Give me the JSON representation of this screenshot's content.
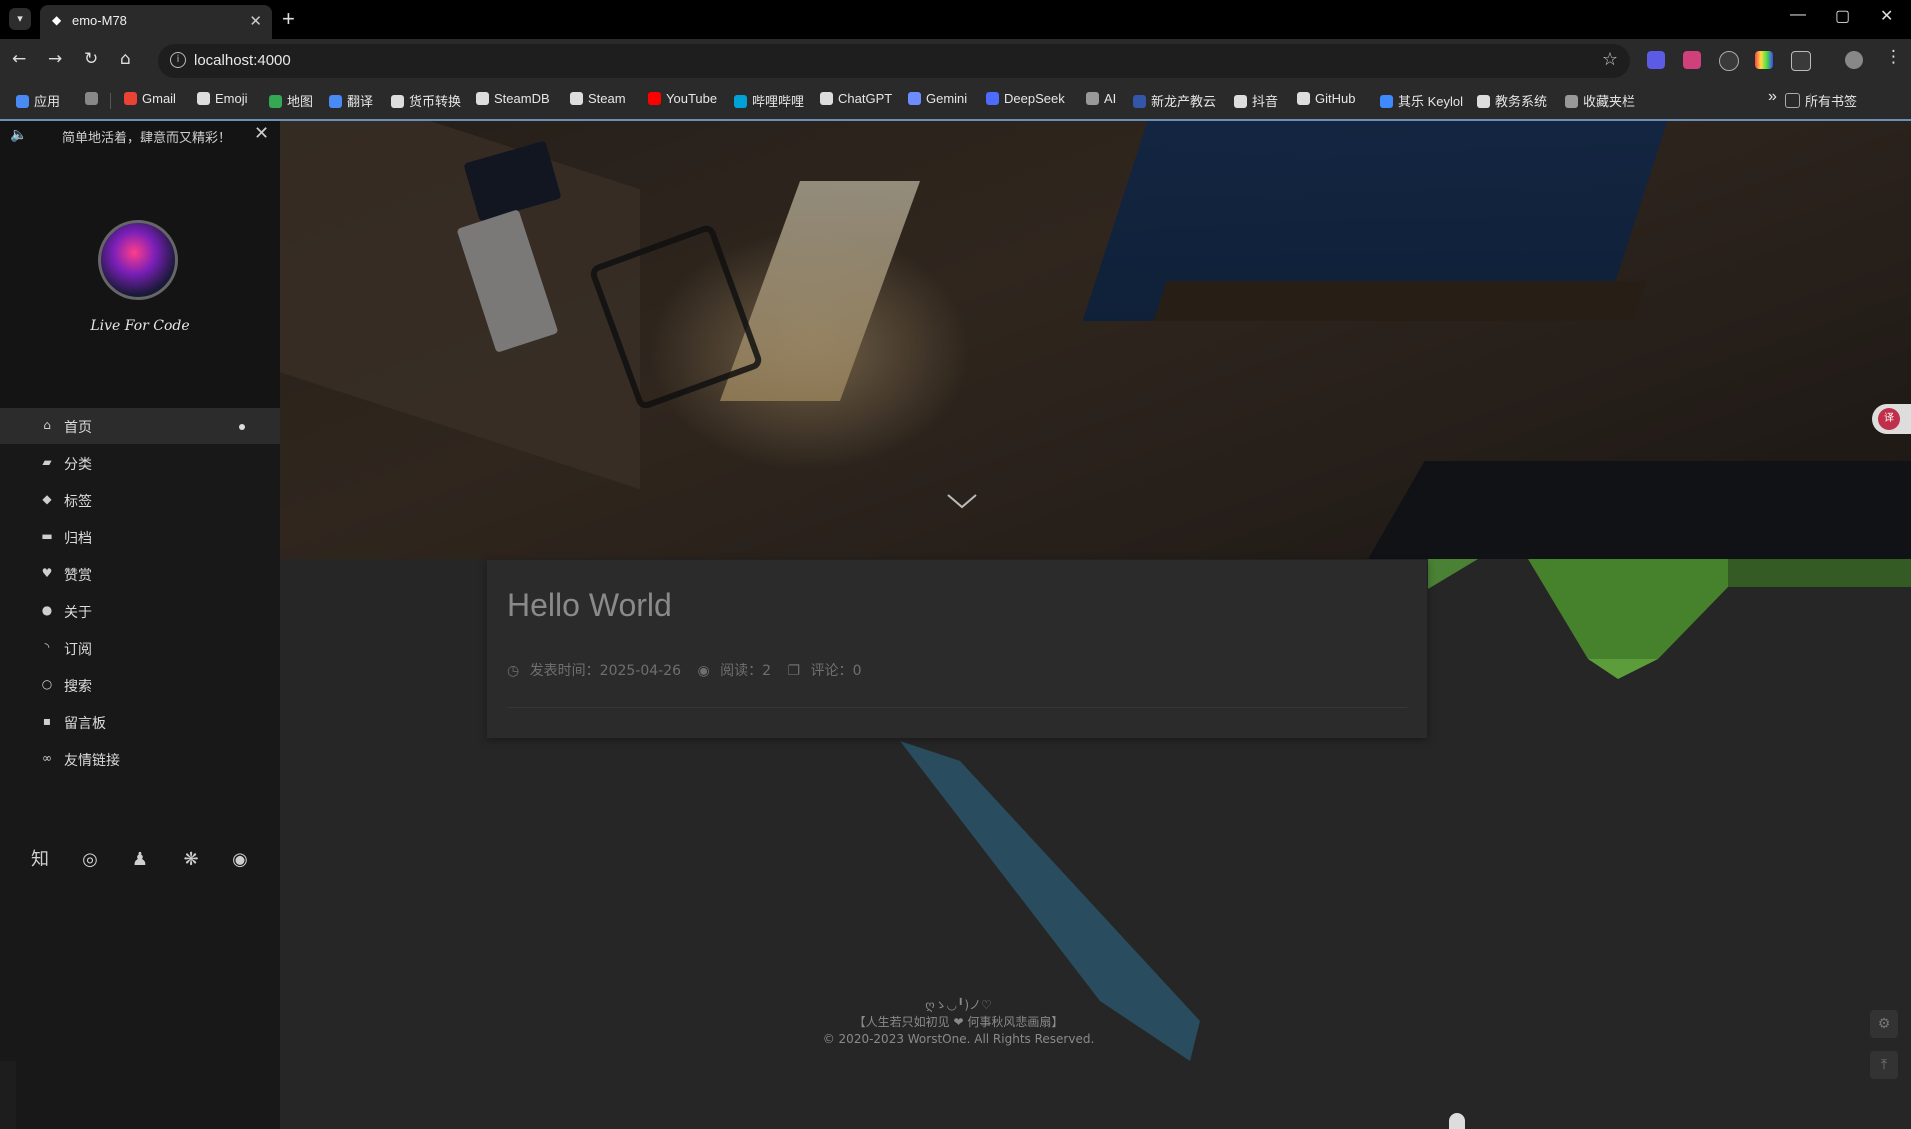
{
  "browser": {
    "tab_title": "emo-M78",
    "url": "localhost:4000",
    "bookmarks": [
      {
        "label": "应用",
        "color": "#4a8af4"
      },
      {
        "label": "",
        "color": "#888888"
      },
      {
        "label": "Gmail",
        "color": "#ea4335"
      },
      {
        "label": "Emoji",
        "color": "#dddddd"
      },
      {
        "label": "地图",
        "color": "#34a853"
      },
      {
        "label": "翻译",
        "color": "#4a8af4"
      },
      {
        "label": "货币转换",
        "color": "#dddddd"
      },
      {
        "label": "SteamDB",
        "color": "#dddddd"
      },
      {
        "label": "Steam",
        "color": "#dddddd"
      },
      {
        "label": "YouTube",
        "color": "#ff0000"
      },
      {
        "label": "哔哩哔哩",
        "color": "#00a1d6"
      },
      {
        "label": "ChatGPT",
        "color": "#dddddd"
      },
      {
        "label": "Gemini",
        "color": "#6c8cff"
      },
      {
        "label": "DeepSeek",
        "color": "#4d6bfe"
      },
      {
        "label": "AI",
        "color": "#999999"
      },
      {
        "label": "新龙产教云",
        "color": "#3355aa"
      },
      {
        "label": "抖音",
        "color": "#dddddd"
      },
      {
        "label": "GitHub",
        "color": "#dddddd"
      },
      {
        "label": "其乐 Keylol",
        "color": "#3d8bff"
      },
      {
        "label": "教务系统",
        "color": "#dddddd"
      },
      {
        "label": "收藏夹栏",
        "color": "#999999"
      }
    ],
    "all_bookmarks": "所有书签"
  },
  "sidebar": {
    "motto": "简单地活着，肆意而又精彩！",
    "site_name": "Live For Code",
    "menu": [
      {
        "label": "首页",
        "icon": "home-icon",
        "glyph": "⌂",
        "active": true
      },
      {
        "label": "分类",
        "icon": "folder-icon",
        "glyph": "▰"
      },
      {
        "label": "标签",
        "icon": "tag-icon",
        "glyph": "◆"
      },
      {
        "label": "归档",
        "icon": "archive-icon",
        "glyph": "▬"
      },
      {
        "label": "赞赏",
        "icon": "heart-icon",
        "glyph": "♥"
      },
      {
        "label": "关于",
        "icon": "user-icon",
        "glyph": "●"
      },
      {
        "label": "订阅",
        "icon": "rss-icon",
        "glyph": "◝"
      },
      {
        "label": "搜索",
        "icon": "search-icon",
        "glyph": "○"
      },
      {
        "label": "留言板",
        "icon": "comment-icon",
        "glyph": "▪"
      },
      {
        "label": "友情链接",
        "icon": "link-icon",
        "glyph": "∞"
      }
    ],
    "socials": [
      {
        "icon": "zhihu-icon",
        "glyph": "知"
      },
      {
        "icon": "weibo-icon",
        "glyph": "◎"
      },
      {
        "icon": "qq-icon",
        "glyph": "♟"
      },
      {
        "icon": "wechat-icon",
        "glyph": "❋"
      },
      {
        "icon": "github-icon",
        "glyph": "◉"
      }
    ]
  },
  "post": {
    "title": "Hello World",
    "published_label": "发表时间：",
    "published_date": "2025-04-26",
    "reads_label": "阅读：",
    "reads": "2",
    "comments_label": "评论：",
    "comments": "0"
  },
  "footer": {
    "kaomoji": "ღゝ◡╹)ノ♡",
    "quote": "【人生若只如初见 ❤ 何事秋风悲画扇】",
    "copyright": "© 2020-2023 WorstOne. All Rights Reserved."
  },
  "theme": {
    "accent": "#6b8fb5",
    "green_poly": "#5aa83a",
    "blue_poly": "#2f7fa3"
  }
}
